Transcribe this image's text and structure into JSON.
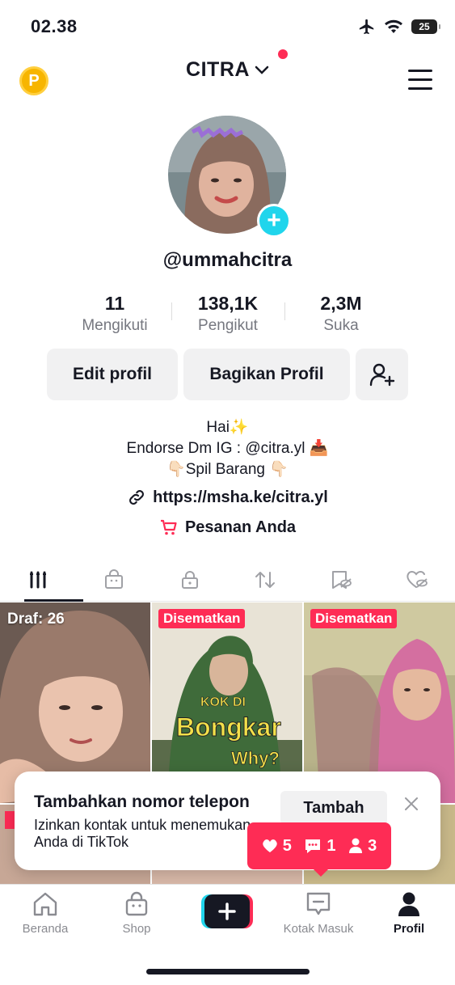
{
  "status_bar": {
    "time": "02.38",
    "battery": "25"
  },
  "header": {
    "coin_label": "P",
    "account_name": "CITRA"
  },
  "profile": {
    "username": "@ummahcitra"
  },
  "stats": [
    {
      "value": "11",
      "label": "Mengikuti"
    },
    {
      "value": "138,1K",
      "label": "Pengikut"
    },
    {
      "value": "2,3M",
      "label": "Suka"
    }
  ],
  "actions": {
    "edit_label": "Edit profil",
    "share_label": "Bagikan Profil"
  },
  "bio": {
    "line1": "Hai✨",
    "line2": "Endorse Dm IG : @citra.yl 📥",
    "line3": "👇🏻Spil Barang 👇🏻",
    "link": "https://msha.ke/citra.yl",
    "orders": "Pesanan Anda"
  },
  "tabs": [
    "videos",
    "shop",
    "private",
    "reposts",
    "favorites",
    "liked"
  ],
  "grid": {
    "draft_label": "Draf: 26",
    "pinned_label": "Disematkan",
    "overlay_line1": "KOK DI",
    "overlay_line2": "Bongkar",
    "overlay_line3": "Why?"
  },
  "toast": {
    "title": "Tambahkan nomor telepon",
    "subtitle": "Izinkan kontak untuk menemukan Anda di TikTok",
    "button": "Tambah"
  },
  "notifications": {
    "likes": "5",
    "comments": "1",
    "followers": "3"
  },
  "bottom_nav": {
    "home": "Beranda",
    "shop": "Shop",
    "inbox": "Kotak Masuk",
    "profile": "Profil"
  },
  "colors": {
    "accent": "#fe2c55",
    "cyan": "#20d5ec",
    "text": "#161823",
    "muted": "#75777f"
  }
}
